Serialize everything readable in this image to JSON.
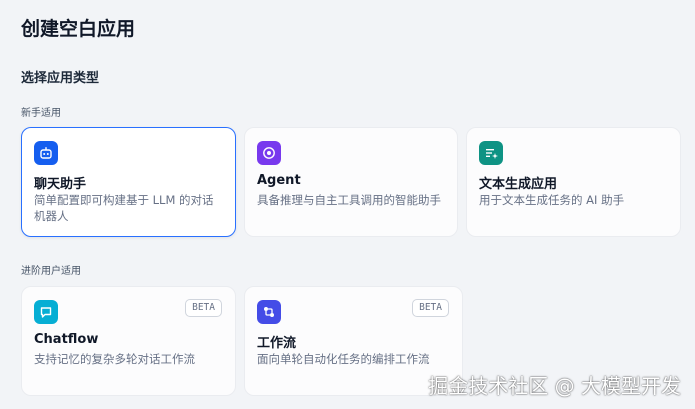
{
  "dialog": {
    "title": "创建空白应用"
  },
  "section": {
    "title": "选择应用类型"
  },
  "groups": [
    {
      "label": "新手适用",
      "cards": [
        {
          "name": "聊天助手",
          "desc": "简单配置即可构建基于 LLM 的对话机器人",
          "icon": "chat-bot-icon",
          "color": "#155eef",
          "selected": true
        },
        {
          "name": "Agent",
          "desc": "具备推理与自主工具调用的智能助手",
          "icon": "agent-icon",
          "color": "#7839ee"
        },
        {
          "name": "文本生成应用",
          "desc": "用于文本生成任务的 AI 助手",
          "icon": "text-generation-icon",
          "color": "#0e9384"
        }
      ]
    },
    {
      "label": "进阶用户适用",
      "cards": [
        {
          "name": "Chatflow",
          "desc": "支持记忆的复杂多轮对话工作流",
          "icon": "chatflow-icon",
          "color": "#06aed4",
          "badge": "BETA"
        },
        {
          "name": "工作流",
          "desc": "面向单轮自动化任务的编排工作流",
          "icon": "workflow-icon",
          "color": "#444ce7",
          "badge": "BETA"
        }
      ]
    }
  ],
  "watermark": "掘金技术社区 @ 大模型开发"
}
